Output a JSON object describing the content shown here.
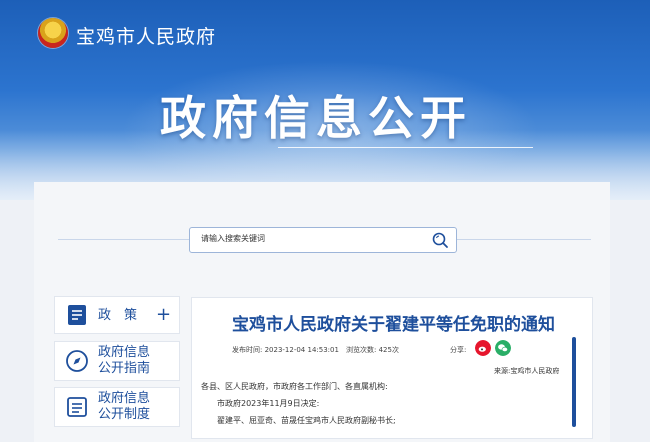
{
  "header": {
    "site_name": "宝鸡市人民政府",
    "banner_title": "政府信息公开"
  },
  "search": {
    "placeholder": "请输入搜索关键词",
    "icon": "search-icon"
  },
  "sidebar": {
    "items": [
      {
        "label_top": "政　策",
        "label_bottom": "",
        "icon": "document-icon",
        "expand": "+"
      },
      {
        "label_top": "政府信息",
        "label_bottom": "公开指南",
        "icon": "compass-icon"
      },
      {
        "label_top": "政府信息",
        "label_bottom": "公开制度",
        "icon": "list-icon"
      }
    ]
  },
  "article": {
    "title": "宝鸡市人民政府关于翟建平等任免职的通知",
    "publish_time": "发布时间: 2023-12-04 14:53:01",
    "views": "浏览次数: 425次",
    "share_label": "分享:",
    "share_icons": [
      "weibo-icon",
      "wechat-icon"
    ],
    "source": "来源:宝鸡市人民政府",
    "body": [
      "各县、区人民政府，市政府各工作部门、各直属机构:",
      "市政府2023年11月9日决定:",
      "翟建平、屈亚奇、苗晟任宝鸡市人民政府副秘书长;"
    ]
  },
  "colors": {
    "primary_blue": "#1e4f9c",
    "banner_blue": "#2c74cf",
    "weibo_red": "#e6162d",
    "wechat_green": "#2aae67"
  }
}
